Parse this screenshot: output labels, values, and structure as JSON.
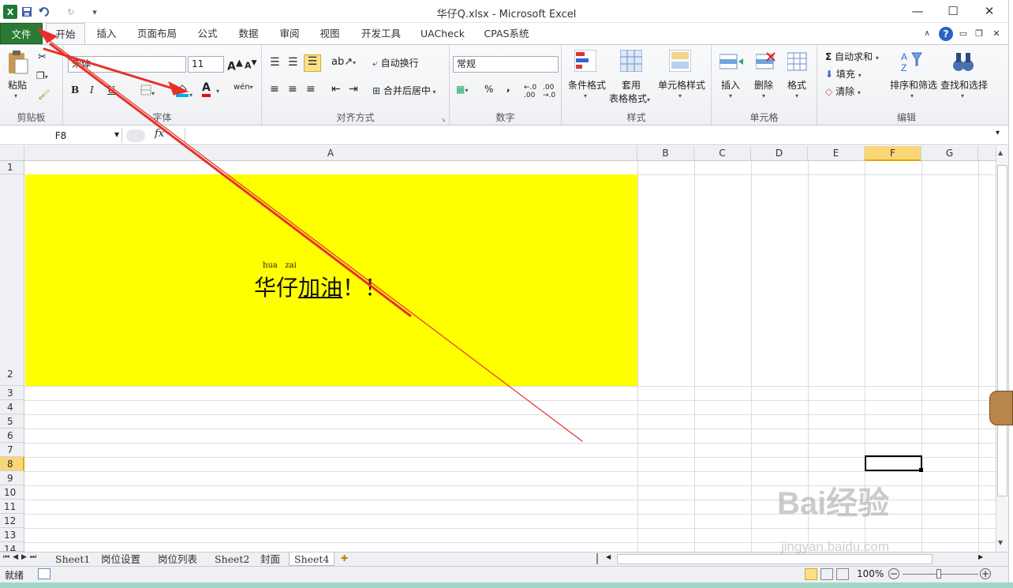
{
  "window": {
    "title": "华仔Q.xlsx - Microsoft Excel"
  },
  "quick_access": {
    "save_icon": "save-icon",
    "undo_icon": "undo-icon",
    "redo_icon": "redo-icon"
  },
  "tabs": [
    {
      "label": "文件"
    },
    {
      "label": "开始"
    },
    {
      "label": "插入"
    },
    {
      "label": "页面布局"
    },
    {
      "label": "公式"
    },
    {
      "label": "数据"
    },
    {
      "label": "审阅"
    },
    {
      "label": "视图"
    },
    {
      "label": "开发工具"
    },
    {
      "label": "UACheck"
    },
    {
      "label": "CPAS系统"
    }
  ],
  "ribbon": {
    "clipboard": {
      "paste": "粘贴",
      "label": "剪贴板"
    },
    "font": {
      "font_name": "宋体",
      "font_size": "11",
      "label": "字体",
      "bold": "B",
      "italic": "I",
      "underline": "U",
      "grow": "A",
      "shrink": "A",
      "font_color_letter": "A",
      "phonetic": "wén"
    },
    "alignment": {
      "wrap": "自动换行",
      "merge": "合并后居中",
      "label": "对齐方式"
    },
    "number": {
      "format": "常规",
      "percent": "%",
      "comma": ",",
      "label": "数字"
    },
    "styles": {
      "cond": "条件格式",
      "table1": "套用",
      "table2": "表格格式",
      "cell": "单元格样式",
      "label": "样式"
    },
    "cells": {
      "insert": "插入",
      "delete": "删除",
      "format": "格式",
      "label": "单元格"
    },
    "editing": {
      "autosum": "自动求和",
      "fill": "填充",
      "clear": "清除",
      "sort": "排序和筛选",
      "find": "查找和选择",
      "label": "编辑"
    }
  },
  "formula_bar": {
    "name_box": "F8",
    "fx": "fx",
    "value": ""
  },
  "columns": [
    "A",
    "B",
    "C",
    "D",
    "E",
    "F",
    "G"
  ],
  "rows": [
    "1",
    "2",
    "3",
    "4",
    "5",
    "6",
    "7",
    "8",
    "9",
    "10",
    "11",
    "12",
    "13",
    "14"
  ],
  "cell_a2": {
    "phonetic_1": "hua",
    "phonetic_2": "zai",
    "text_plain": "华仔",
    "text_underlined": "加油",
    "text_tail": "！！",
    "fill": "#ffff00"
  },
  "sheets": [
    {
      "name": "Sheet1",
      "active": false
    },
    {
      "name": "岗位设置",
      "active": false
    },
    {
      "name": "岗位列表",
      "active": false
    },
    {
      "name": "Sheet2",
      "active": false
    },
    {
      "name": "封面",
      "active": false
    },
    {
      "name": "Sheet4",
      "active": true
    }
  ],
  "status": {
    "mode": "就绪",
    "zoom": "100%"
  },
  "watermark": {
    "brand": "Bai经验",
    "url": "jingyan.baidu.com"
  },
  "annotation_color": "#e8302a"
}
